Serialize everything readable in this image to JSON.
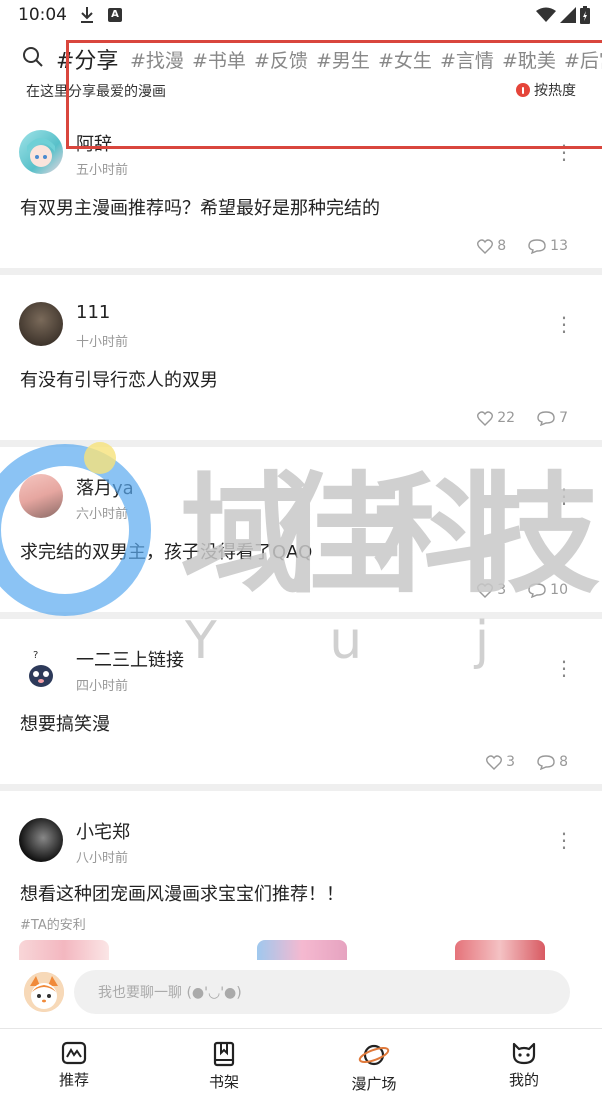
{
  "status": {
    "time": "10:04",
    "download_icon": "download-icon",
    "a_badge": "A"
  },
  "topics": {
    "tags": [
      "#分享",
      "#找漫",
      "#书单",
      "#反馈",
      "#男生",
      "#女生",
      "#言情",
      "#耽美",
      "#后宫"
    ],
    "active_index": 0,
    "subtitle": "在这里分享最爱的漫画",
    "sort_label": "按热度"
  },
  "posts": [
    {
      "user": "阿辞",
      "time": "五小时前",
      "content": "有双男主漫画推荐吗？希望最好是那种完结的",
      "likes": "8",
      "comments": "13"
    },
    {
      "user": "111",
      "time": "十小时前",
      "content": "有没有引导行恋人的双男",
      "likes": "22",
      "comments": "7"
    },
    {
      "user": "落月ya",
      "time": "六小时前",
      "content": "求完结的双男主，孩子没得看了QAQ",
      "likes": "3",
      "comments": "10"
    },
    {
      "user": "一二三上链接",
      "time": "四小时前",
      "content": "想要搞笑漫",
      "likes": "3",
      "comments": "8"
    },
    {
      "user": "小宅郑",
      "time": "八小时前",
      "content": "想看这种团宠画风漫画求宝宝们推荐！！",
      "tag": "#TA的安利"
    }
  ],
  "watermark": {
    "brand": "域佳科技",
    "latin": "Y u j a"
  },
  "chat": {
    "placeholder": "我也要聊一聊 (●'◡'●)"
  },
  "nav": {
    "items": [
      {
        "label": "推荐",
        "icon": "recommend-icon"
      },
      {
        "label": "书架",
        "icon": "bookshelf-icon"
      },
      {
        "label": "漫广场",
        "icon": "planet-icon"
      },
      {
        "label": "我的",
        "icon": "cat-face-icon"
      }
    ]
  },
  "colors": {
    "accent_red": "#d9463d",
    "sort_dot": "#e5453a",
    "watermark_gray": "#c8c8c8",
    "watermark_blue": "#5aa9f0"
  }
}
